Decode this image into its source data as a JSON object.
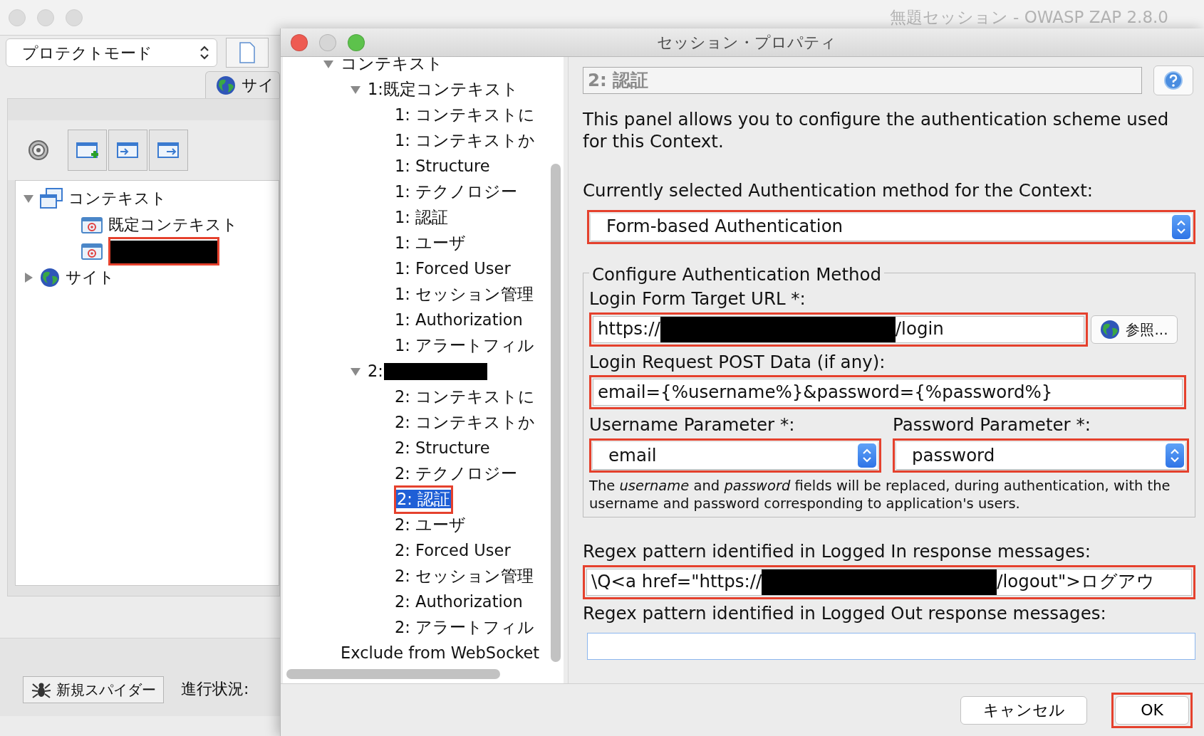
{
  "app_window": {
    "title": "無題セッション - OWASP ZAP 2.8.0",
    "mode_select": "プロテクトモード",
    "tab": "サイ",
    "tree": [
      {
        "label": "コンテキスト",
        "kind": "contexts",
        "expanded": true,
        "children": [
          {
            "label": "既定コンテキスト",
            "kind": "context",
            "redacted": false,
            "highlighted": false
          },
          {
            "kind": "context",
            "redacted": true,
            "highlighted": true
          }
        ]
      },
      {
        "label": "サイト",
        "kind": "sites",
        "expanded": false
      }
    ],
    "spider_button": "新規スパイダー",
    "progress_label": "進行状況:"
  },
  "dialog": {
    "title": "セッション・プロパティ",
    "tree": [
      {
        "label": "コンテキスト",
        "expanded": true,
        "selected": false,
        "children": [
          {
            "label": "1:既定コンテキスト",
            "expanded": true,
            "selected": false,
            "children": [
              {
                "label": "1: コンテキストに",
                "selected": false
              },
              {
                "label": "1: コンテキストか",
                "selected": false
              },
              {
                "label": "1: Structure",
                "selected": false
              },
              {
                "label": "1: テクノロジー",
                "selected": false
              },
              {
                "label": "1: 認証",
                "selected": false
              },
              {
                "label": "1: ユーザ",
                "selected": false
              },
              {
                "label": "1: Forced User",
                "selected": false
              },
              {
                "label": "1: セッション管理",
                "selected": false
              },
              {
                "label": "1: Authorization",
                "selected": false
              },
              {
                "label": "1: アラートフィル",
                "selected": false
              }
            ]
          },
          {
            "label": "2:",
            "redacted": true,
            "expanded": true,
            "selected": false,
            "children": [
              {
                "label": "2: コンテキストに",
                "selected": false
              },
              {
                "label": "2: コンテキストか",
                "selected": false
              },
              {
                "label": "2: Structure",
                "selected": false
              },
              {
                "label": "2: テクノロジー",
                "selected": false
              },
              {
                "label": "2: 認証",
                "selected": true,
                "highlighted": true
              },
              {
                "label": "2: ユーザ",
                "selected": false
              },
              {
                "label": "2: Forced User",
                "selected": false
              },
              {
                "label": "2: セッション管理",
                "selected": false
              },
              {
                "label": "2: Authorization",
                "selected": false
              },
              {
                "label": "2: アラートフィル",
                "selected": false
              }
            ]
          }
        ]
      },
      {
        "label": "Exclude from WebSocket",
        "selected": false
      }
    ],
    "panel_title": "2: 認証",
    "description": "This panel allows you to configure the authentication scheme used for this Context.",
    "method_label": "Currently selected Authentication method for the Context:",
    "method_select": {
      "value": "Form-based Authentication",
      "highlighted": true
    },
    "method_group": {
      "legend": "Configure Authentication Method",
      "login_url": {
        "label": "Login Form Target URL *:",
        "value_before": "https://",
        "redacted": true,
        "value_after": "/login",
        "highlighted": true
      },
      "browse_button": "参照...",
      "post_data": {
        "label": "Login Request POST Data (if any):",
        "value": "email={%username%}&password={%password%}",
        "highlighted": true
      },
      "username_param": {
        "label": "Username Parameter *:",
        "value": "email",
        "highlighted": true
      },
      "password_param": {
        "label": "Password Parameter *:",
        "value": "password",
        "highlighted": true
      },
      "note": "The *username* and *password* fields will be replaced, during authentication, with the username and password corresponding to application's users."
    },
    "logged_in": {
      "label": "Regex pattern identified in Logged In response messages:",
      "value_before": "\\Q<a href=\"https://",
      "redacted": true,
      "value_after": "/logout\">ログアウ",
      "highlighted": true
    },
    "logged_out": {
      "label": "Regex pattern identified in Logged Out response messages:"
    },
    "buttons": [
      {
        "label": "キャンセル",
        "highlighted": false
      },
      {
        "label": "OK",
        "highlighted": true
      }
    ]
  }
}
